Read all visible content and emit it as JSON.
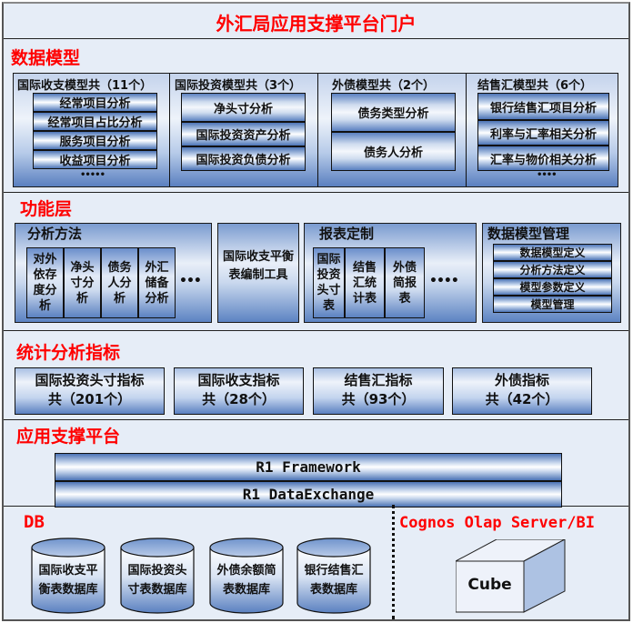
{
  "page_title": "外汇局应用支撑平台门户",
  "colors": {
    "section_title": "#ff0000",
    "background": "#e6edf7",
    "accent_blue": "#4c74b6"
  },
  "data_model": {
    "title": "数据模型",
    "groups": [
      {
        "title": "国际收支模型共（11个）",
        "items": [
          "经常项目分析",
          "经常项目占比分析",
          "服务项目分析",
          "收益项目分析"
        ],
        "more": "•••••"
      },
      {
        "title": "国际投资模型共（3个）",
        "items": [
          "净头寸分析",
          "国际投资资产分析",
          "国际投资负债分析"
        ]
      },
      {
        "title": "外债模型共（2个）",
        "items": [
          "债务类型分析",
          "债务人分析"
        ]
      },
      {
        "title": "结售汇模型共（6个）",
        "items": [
          "银行结售汇项目分析",
          "利率与汇率相关分析",
          "汇率与物价相关分析"
        ],
        "more": "••••"
      }
    ]
  },
  "function_layer": {
    "title": "功能层",
    "analysis_methods": {
      "title": "分析方法",
      "items": [
        "对外依存度分析",
        "净头寸分析",
        "债务人分析",
        "外汇储备分析"
      ],
      "more": "•••"
    },
    "bop_tool": {
      "label": "国际收支平衡表编制工具"
    },
    "report_custom": {
      "title": "报表定制",
      "items": [
        "国际投资头寸表",
        "结售汇统计表",
        "外债简报表"
      ],
      "more": "••••"
    },
    "model_management": {
      "title": "数据模型管理",
      "items": [
        "数据模型定义",
        "分析方法定义",
        "模型参数定义",
        "模型管理"
      ]
    }
  },
  "indicators": {
    "title": "统计分析指标",
    "items": [
      {
        "line1": "国际投资头寸指标",
        "line2": "共（201个）"
      },
      {
        "line1": "国际收支指标",
        "line2": "共（28个）"
      },
      {
        "line1": "结售汇指标",
        "line2": "共（93个）"
      },
      {
        "line1": "外债指标",
        "line2": "共（42个）"
      }
    ]
  },
  "platform": {
    "title": "应用支撑平台",
    "items": [
      "R1 Framework",
      "R1 DataExchange"
    ]
  },
  "db": {
    "title": "DB",
    "databases": [
      {
        "line1": "国际收支平",
        "line2": "衡表数据库"
      },
      {
        "line1": "国际投资头",
        "line2": "寸表数据库"
      },
      {
        "line1": "外债余额简",
        "line2": "表数据库"
      },
      {
        "line1": "银行结售汇",
        "line2": "表数据库"
      }
    ]
  },
  "olap": {
    "title": "Cognos Olap Server/BI",
    "cube_label": "Cube"
  }
}
